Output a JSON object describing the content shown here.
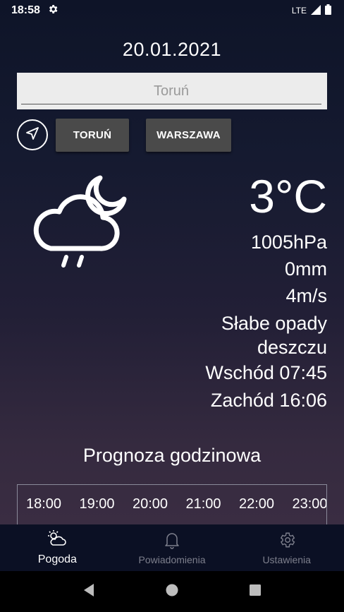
{
  "status_bar": {
    "time": "18:58",
    "network": "LTE"
  },
  "date": "20.01.2021",
  "search": {
    "placeholder": "Toruń"
  },
  "city_buttons": [
    {
      "label": "TORUŃ"
    },
    {
      "label": "WARSZAWA"
    }
  ],
  "weather": {
    "icon": "cloud-moon-rain-icon",
    "temperature": "3°C",
    "pressure": "1005hPa",
    "precipitation": "0mm",
    "wind": "4m/s",
    "description_line1": "Słabe opady",
    "description_line2": "deszczu",
    "sunrise": "Wschód 07:45",
    "sunset": "Zachód 16:06"
  },
  "forecast": {
    "title": "Prognoza godzinowa",
    "hours": [
      "18:00",
      "19:00",
      "20:00",
      "21:00",
      "22:00",
      "23:00"
    ]
  },
  "bottom_nav": [
    {
      "label": "Pogoda",
      "icon": "weather-icon",
      "active": true
    },
    {
      "label": "Powiadomienia",
      "icon": "bell-icon",
      "active": false
    },
    {
      "label": "Ustawienia",
      "icon": "gear-icon",
      "active": false
    }
  ],
  "colors": {
    "background_top": "#0e1428",
    "background_bottom": "#3a2d42",
    "button": "#4a4a4a",
    "nav_inactive": "#7d7f8c"
  }
}
